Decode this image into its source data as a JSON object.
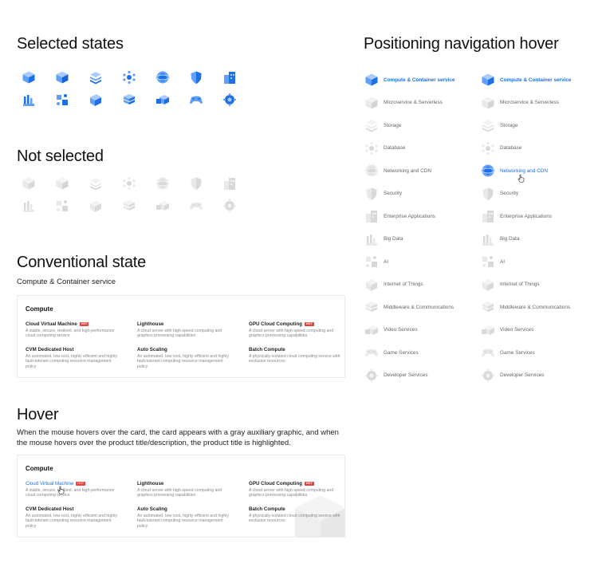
{
  "sections": {
    "selected": "Selected states",
    "not_selected": "Not selected",
    "conventional": "Conventional state",
    "conventional_sub": "Compute & Container service",
    "hover": "Hover",
    "hover_desc": "When the mouse hovers over the card, the card appears with a gray auxiliary graphic, and when the mouse hovers over the product title/description, the product title is highlighted.",
    "positioning": "Positioning navigation hover"
  },
  "colors": {
    "accent": "#1f6fe5",
    "tag": "#e9413b",
    "muted": "#666666"
  },
  "icons": [
    "cube-icon",
    "cube-solid-icon",
    "layers-icon",
    "network-icon",
    "globe-icon",
    "shield-icon",
    "building-icon",
    "chart-icon",
    "ai-icon",
    "iot-icon",
    "stack-icon",
    "video-icon",
    "gamepad-icon",
    "gear-icon"
  ],
  "card": {
    "title": "Compute",
    "products": [
      {
        "name": "Cloud Virtual Machine",
        "tag": "HOT",
        "desc": "A stable, secure, resilient, and high-performance cloud computing service"
      },
      {
        "name": "Lighthouse",
        "tag": "",
        "desc": "A cloud server with high-speed computing and graphics processing capabilities"
      },
      {
        "name": "GPU Cloud Computing",
        "tag": "HOT",
        "desc": "A cloud server with high-speed computing and graphics processing capabilities"
      },
      {
        "name": "CVM Dedicated Host",
        "tag": "",
        "desc": "An automated, low-cost, highly efficient and highly fault-tolerant computing resource management policy"
      },
      {
        "name": "Auto Scaling",
        "tag": "",
        "desc": "An automated, low-cost, highly efficient and highly fault-tolerant computing resource management policy"
      },
      {
        "name": "Batch Compute",
        "tag": "",
        "desc": "A physically-isolated cloud computing service with exclusive resources"
      }
    ]
  },
  "nav": {
    "items": [
      "Compute & Container service",
      "Microservice & Serverless",
      "Storage",
      "Database",
      "Networking and CDN",
      "Security",
      "Enterprise Applications",
      "Big Data",
      "AI",
      "Internet of Things",
      "Middleware & Communications",
      "Video Services",
      "Game Services",
      "Developer Services"
    ]
  }
}
